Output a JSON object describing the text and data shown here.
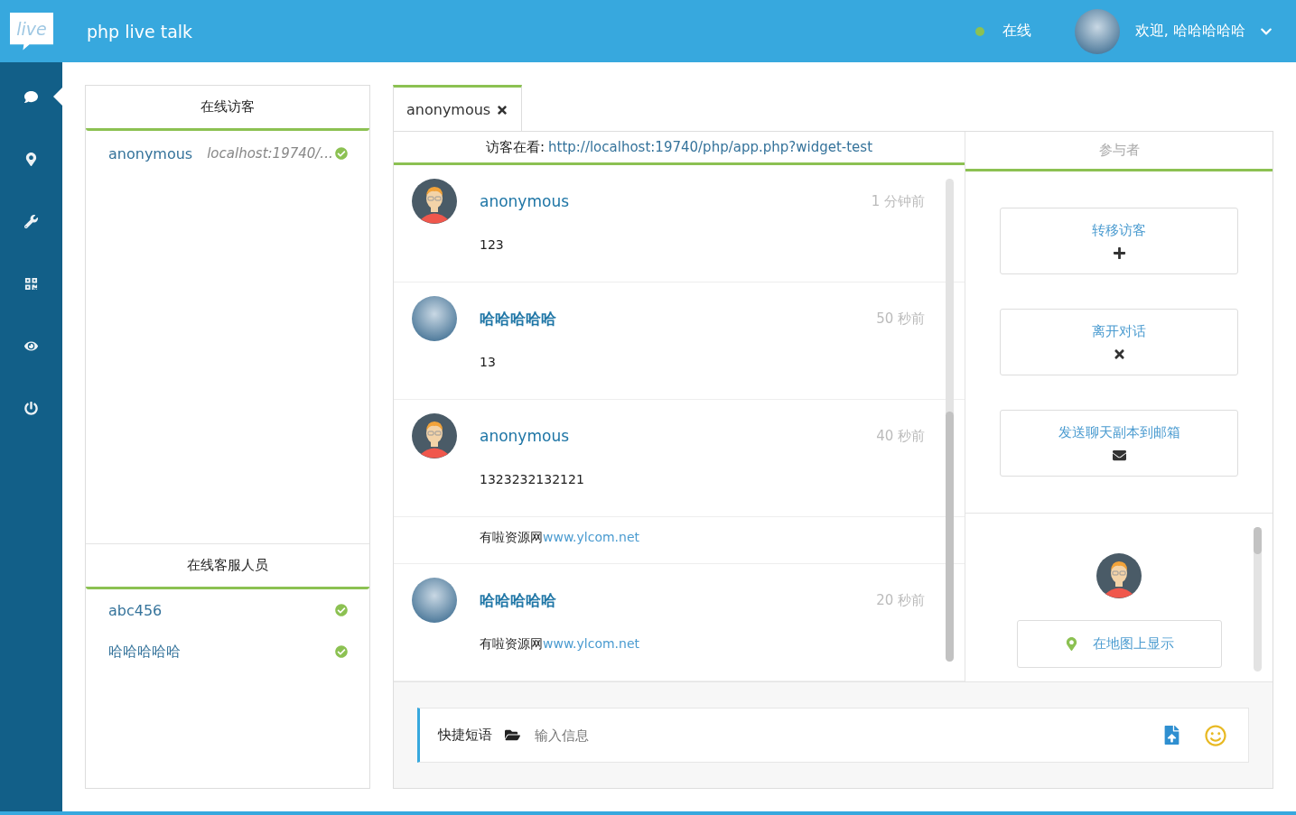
{
  "header": {
    "logo": "live",
    "title": "php live talk",
    "status": {
      "label": "在线",
      "color": "#8cc152"
    },
    "welcome": "欢迎, 哈哈哈哈哈"
  },
  "nav": [
    {
      "selected": true
    },
    {
      "selected": false
    },
    {
      "selected": false
    },
    {
      "selected": false
    },
    {
      "selected": false
    },
    {
      "selected": false
    }
  ],
  "visitors": {
    "title": "在线访客",
    "items": [
      {
        "name": "anonymous",
        "page": "localhost:19740/...",
        "online": true
      }
    ]
  },
  "agents": {
    "title": "在线客服人员",
    "items": [
      {
        "name": "abc456",
        "online": true
      },
      {
        "name": "哈哈哈哈哈",
        "online": true
      }
    ]
  },
  "chat_tabs": [
    {
      "label": "anonymous",
      "selected": true
    }
  ],
  "viewing": {
    "label": "访客在看:",
    "url": "http://localhost:19740/php/app.php?widget-test"
  },
  "messages": [
    {
      "kind": "visitor",
      "author": "anonymous",
      "time": "1 分钟前",
      "text": "123"
    },
    {
      "kind": "agent",
      "author": "哈哈哈哈哈",
      "time": "50 秒前",
      "text": "13"
    },
    {
      "kind": "visitor",
      "author": "anonymous",
      "time": "40 秒前",
      "text": "1323232132121"
    },
    {
      "kind": "note",
      "text": "有啦资源网",
      "link": "www.ylcom.net"
    },
    {
      "kind": "agent",
      "author": "哈哈哈哈哈",
      "time": "20 秒前",
      "text": "有啦资源网",
      "link": "www.ylcom.net"
    }
  ],
  "participants": {
    "title": "参与者",
    "actions": [
      {
        "label": "转移访客"
      },
      {
        "label": "离开对话"
      },
      {
        "label": "发送聊天副本到邮箱"
      }
    ],
    "map_button": "在地图上显示"
  },
  "composer": {
    "quick_replies": "快捷短语",
    "placeholder": "输入信息"
  }
}
